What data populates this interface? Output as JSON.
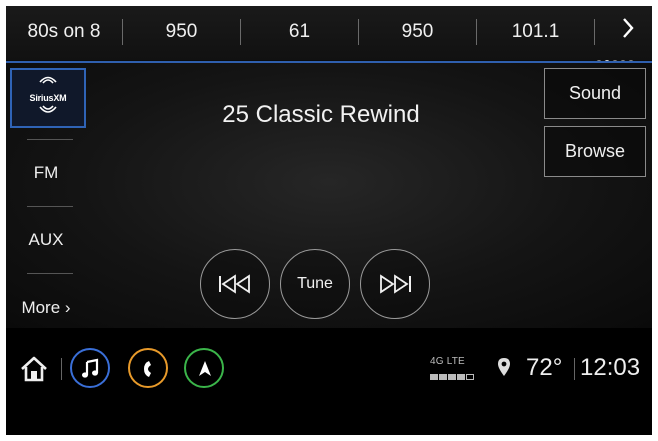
{
  "presets": {
    "items": [
      "80s on 8",
      "950",
      "61",
      "950",
      "101.1"
    ],
    "next_icon": "chevron-right-icon",
    "page_count": 5,
    "active_page": 1
  },
  "sources": {
    "siriusxm_logo": "SiriusXM",
    "fm": "FM",
    "aux": "AUX",
    "more": "More ›"
  },
  "station": "25 Classic Rewind",
  "side_buttons": {
    "sound": "Sound",
    "browse": "Browse"
  },
  "controls": {
    "seek_back_icon": "seek-back-icon",
    "tune": "Tune",
    "seek_forward_icon": "seek-forward-icon"
  },
  "bottom_bar": {
    "home_icon": "home-icon",
    "apps": [
      {
        "name": "audio-icon",
        "color": "#3a6fd8"
      },
      {
        "name": "phone-icon",
        "color": "#e89a2a"
      },
      {
        "name": "navigation-icon",
        "color": "#3bb54a"
      }
    ],
    "network": "4G LTE",
    "signal_strength_bars": 4,
    "temperature": "72°",
    "time": "12:03"
  }
}
